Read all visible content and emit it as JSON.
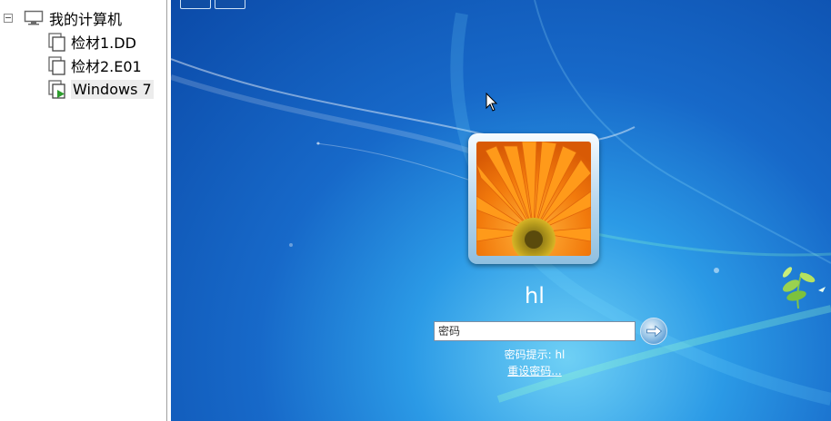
{
  "tree": {
    "root": {
      "label": "我的计算机",
      "icon": "computer-icon",
      "expanded": true
    },
    "items": [
      {
        "label": "检材1.DD",
        "icon": "disk-image-icon"
      },
      {
        "label": "检材2.E01",
        "icon": "disk-image-icon"
      },
      {
        "label": "Windows 7",
        "icon": "virtual-machine-running-icon",
        "selected": true
      }
    ]
  },
  "login": {
    "username": "hl",
    "password_placeholder": "密码",
    "password_hint": "密码提示: hl",
    "reset_link": "重设密码..."
  },
  "colors": {
    "desktop_blue": "#1769c9",
    "flower_orange": "#f27a0c"
  }
}
